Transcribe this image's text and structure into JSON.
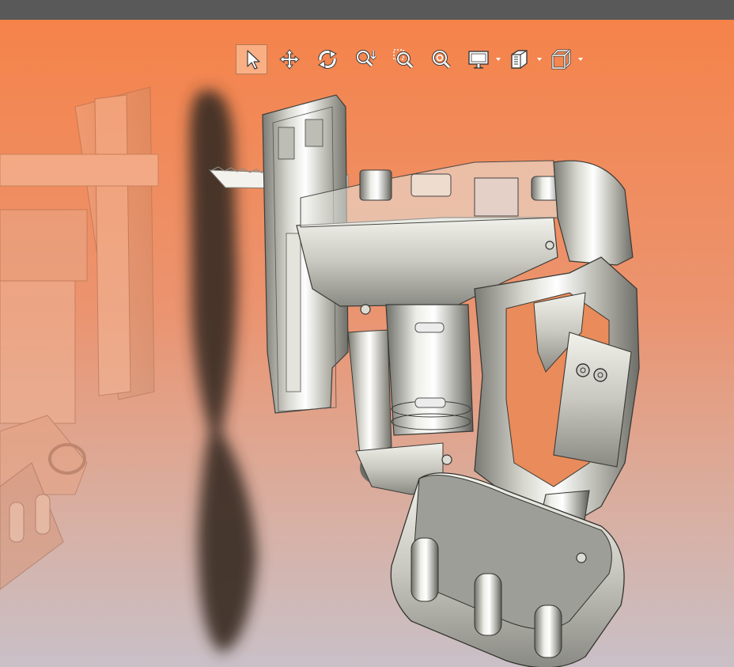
{
  "app": {
    "theme": {
      "titlebar": "#595959",
      "bg_top": "#f5834a",
      "bg_mid": "#e8997a",
      "bg_bottom": "#c9c0c7",
      "icon_color": "#ffffff"
    }
  },
  "toolbar": {
    "tools": [
      {
        "id": "select",
        "icon": "cursor-arrow-icon",
        "active": true
      },
      {
        "id": "pan",
        "icon": "move-arrows-icon",
        "active": false
      },
      {
        "id": "rotate",
        "icon": "rotate-arrows-icon",
        "active": false
      },
      {
        "id": "zoom",
        "icon": "zoom-arrow-icon",
        "active": false
      },
      {
        "id": "zoom-window",
        "icon": "zoom-window-icon",
        "active": false
      },
      {
        "id": "zoom-fit",
        "icon": "zoom-fit-icon",
        "active": false
      },
      {
        "id": "display",
        "icon": "monitor-icon",
        "active": false,
        "dropdown": true
      },
      {
        "id": "section",
        "icon": "section-view-icon",
        "active": false,
        "dropdown": true
      },
      {
        "id": "view-orientation",
        "icon": "cube-view-icon",
        "active": false,
        "dropdown": true
      }
    ]
  },
  "scene": {
    "model": "cordless-jigsaw-assembly",
    "rendering": "transparent-housing-with-reflection-and-shadow"
  }
}
